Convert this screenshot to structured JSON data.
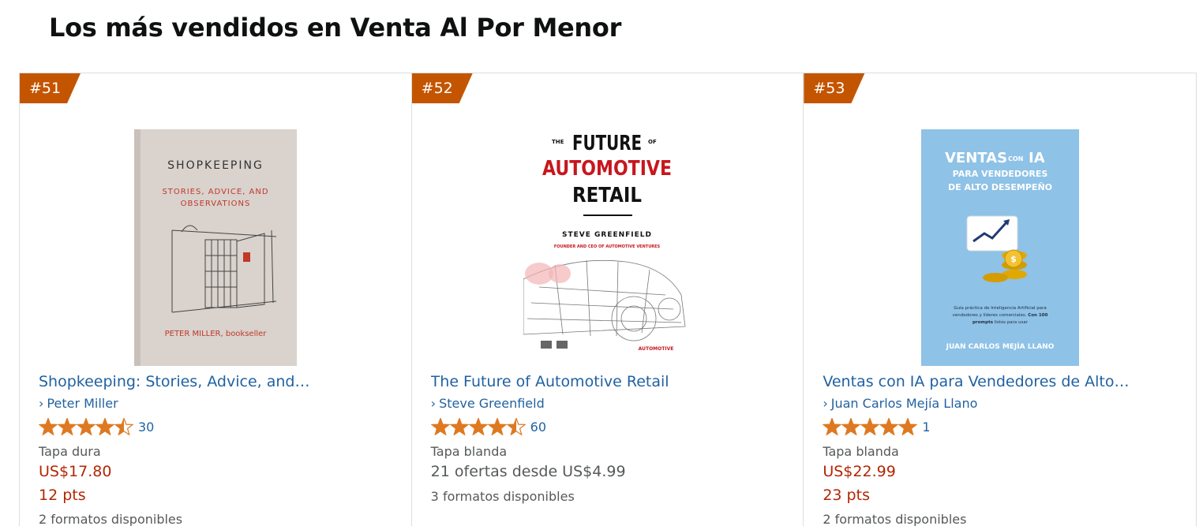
{
  "page": {
    "title": "Los más vendidos en Venta Al Por Menor"
  },
  "colors": {
    "badge": "#c45500",
    "link": "#2162a1",
    "price": "#b12704",
    "star": "#de7921",
    "secondary": "#565959"
  },
  "products": [
    {
      "rank": "#51",
      "cover": {
        "title": "SHOPKEEPING",
        "subtitle_line1": "STORIES, ADVICE, AND",
        "subtitle_line2": "OBSERVATIONS",
        "author": "PETER MILLER, bookseller"
      },
      "title": "Shopkeeping: Stories, Advice, and…",
      "author_chevron": "›",
      "author": "Peter Miller",
      "rating": 4.5,
      "rating_count": "30",
      "format": "Tapa dura",
      "price": "US$17.80",
      "points": "12 pts",
      "formats": "2 formatos disponibles"
    },
    {
      "rank": "#52",
      "cover": {
        "the": "THE",
        "future": "FUTURE",
        "of": "OF",
        "line2": "AUTOMOTIVE",
        "line3": "RETAIL",
        "author": "STEVE GREENFIELD",
        "role": "FOUNDER AND CEO OF AUTOMOTIVE VENTURES",
        "logo": "AUTOMOTIVE"
      },
      "title": "The Future of Automotive Retail",
      "author_chevron": "›",
      "author": "Steve Greenfield",
      "rating": 4.5,
      "rating_count": "60",
      "format": "Tapa blanda",
      "offers": "21 ofertas desde US$4.99",
      "formats": "3 formatos disponibles"
    },
    {
      "rank": "#53",
      "cover": {
        "ventas": "VENTAS",
        "con": "CON",
        "ia": "IA",
        "line2": "PARA VENDEDORES",
        "line3": "DE ALTO DESEMPEÑO",
        "blurb_line1": "Guía práctica de Inteligencia Artificial para",
        "blurb_line2a": "vendedores y líderes comerciales.",
        "blurb_line2b": "Con 100",
        "blurb_line3a": "prompts",
        "blurb_line3b": "listos para usar",
        "author": "JUAN CARLOS MEJÍA LLANO"
      },
      "title": "Ventas con IA para Vendedores de Alto…",
      "author_chevron": "›",
      "author": "Juan Carlos Mejía Llano",
      "rating": 5,
      "rating_count": "1",
      "format": "Tapa blanda",
      "price": "US$22.99",
      "points": "23 pts",
      "formats": "2 formatos disponibles"
    }
  ]
}
